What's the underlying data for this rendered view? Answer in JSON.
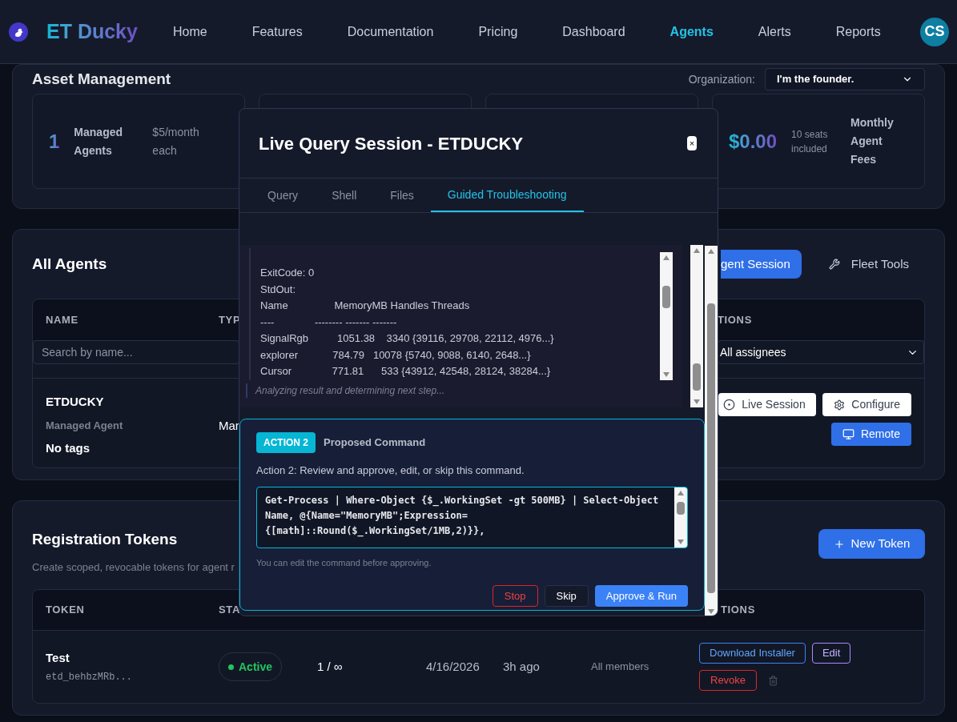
{
  "header": {
    "brand": "ET Ducky",
    "nav": [
      {
        "label": "Home",
        "selected": false
      },
      {
        "label": "Features",
        "selected": false
      },
      {
        "label": "Documentation",
        "selected": false
      },
      {
        "label": "Pricing",
        "selected": false
      },
      {
        "label": "Dashboard",
        "selected": false
      },
      {
        "label": "Agents",
        "selected": true
      },
      {
        "label": "Alerts",
        "selected": false
      },
      {
        "label": "Reports",
        "selected": false
      }
    ],
    "avatar": "CS"
  },
  "asset_management": {
    "title": "Asset Management",
    "organization_label": "Organization:",
    "organization_value": "I'm the founder.",
    "agents_card": {
      "value": "1",
      "label": "Managed Agents",
      "note": "$5/month each"
    },
    "fees_card": {
      "value": "$0.00",
      "note": "10 seats included",
      "label": "Monthly Agent Fees"
    }
  },
  "all_agents": {
    "title": "All Agents",
    "session_button": "gent Session",
    "fleet_tools": "Fleet Tools",
    "columns": [
      "NAME",
      "TYP",
      "TIONS"
    ],
    "search": {
      "placeholder": "Search by name..."
    },
    "assignee_filter": "All assignees",
    "rows": [
      {
        "name": "ETDUCKY",
        "kind": "Managed Agent",
        "tags": "No tags",
        "type": "Mar",
        "actions": [
          "Live Session",
          "Configure",
          "Remote"
        ]
      }
    ]
  },
  "registration_tokens": {
    "title": "Registration Tokens",
    "subtitle": "Create scoped, revocable tokens for agent r",
    "new_button": "New Token",
    "columns": [
      "TOKEN",
      "STA",
      "TIONS"
    ],
    "rows": [
      {
        "name": "Test",
        "token": "etd_behbzMRb...",
        "status": "Active",
        "uses": "1 / ∞",
        "created": "4/16/2026",
        "last_used": "3h ago",
        "scope": "All members",
        "actions": [
          "Download Installer",
          "Edit",
          "Revoke"
        ]
      }
    ]
  },
  "modal": {
    "title": "Live Query Session - ETDUCKY",
    "close": "×",
    "tabs": [
      {
        "label": "Query",
        "selected": false
      },
      {
        "label": "Shell",
        "selected": false
      },
      {
        "label": "Files",
        "selected": false
      },
      {
        "label": "Guided Troubleshooting",
        "selected": true
      }
    ],
    "output_lines": [
      "ExitCode: 0",
      "StdOut:",
      "Name                MemoryMB Handles Threads",
      "----              -------- ------- -------",
      "SignalRgb          1051.38    3340 {39116, 29708, 22112, 4976...}",
      "explorer            784.79   10078 {5740, 9088, 6140, 2648...}",
      "Cursor              771.81      533 {43912, 42548, 28124, 38284...}"
    ],
    "status": "Analyzing result and determining next step...",
    "action": {
      "badge": "ACTION 2",
      "heading": "Proposed Command",
      "description": "Action 2: Review and approve, edit, or skip this command.",
      "command": "Get-Process | Where-Object {$_.WorkingSet -gt 500MB} | Select-Object Name, @{Name=\"MemoryMB\";Expression={[math]::Round($_.WorkingSet/1MB,2)}},",
      "hint": "You can edit the command before approving.",
      "buttons": [
        {
          "label": "Stop",
          "kind": "danger"
        },
        {
          "label": "Skip",
          "kind": "neutral"
        },
        {
          "label": "Approve & Run",
          "kind": "primary"
        }
      ]
    }
  }
}
